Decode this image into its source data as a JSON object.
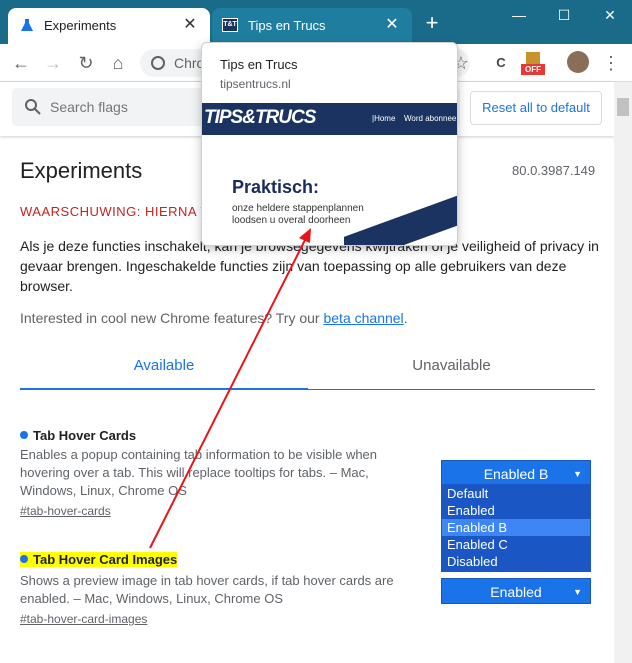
{
  "browser": {
    "tabs": [
      {
        "title": "Experiments",
        "close": "✕"
      },
      {
        "title": "Tips en Trucs",
        "close": "✕"
      }
    ],
    "new_tab": "+",
    "window": {
      "minimize": "—",
      "maximize": "☐",
      "close": "✕"
    },
    "omnibox_text": "Chro",
    "ext_c": "C",
    "ext_off_badge": "OFF",
    "nav": {
      "back": "←",
      "forward": "→",
      "reload": "↻",
      "home": "⌂"
    },
    "star": "☆",
    "menu": "⋮"
  },
  "hover_card": {
    "title": "Tips en Trucs",
    "url": "tipsentrucs.nl",
    "logo": "TIPS&TRUCS",
    "nav_home": "|Home",
    "nav_abonnee": "Word abonnee",
    "headline": "Praktisch:",
    "sub1": "onze heldere stappenplannen",
    "sub2": "loodsen u overal doorheen"
  },
  "flags_page": {
    "search_placeholder": "Search flags",
    "reset_label": "Reset all to default",
    "title": "Experiments",
    "version": "80.0.3987.149",
    "warning": "WAARSCHUWING: HIERNA V",
    "intro": "Als je deze functies inschakelt, kan je browsegegevens kwijtraken of je veiligheid of privacy in gevaar brengen. Ingeschakelde functies zijn van toepassing op alle gebruikers van deze browser.",
    "interested_prefix": "Interested in cool new Chrome features? Try our ",
    "beta_link": "beta channel",
    "interested_suffix": ".",
    "tabs": {
      "available": "Available",
      "unavailable": "Unavailable"
    },
    "flags": [
      {
        "title": "Tab Hover Cards",
        "description": "Enables a popup containing tab information to be visible when hovering over a tab. This will replace tooltips for tabs. – Mac, Windows, Linux, Chrome OS",
        "link": "#tab-hover-cards",
        "selected": "Enabled B",
        "options": [
          "Default",
          "Enabled",
          "Enabled B",
          "Enabled C",
          "Disabled"
        ]
      },
      {
        "title": "Tab Hover Card Images",
        "description": "Shows a preview image in tab hover cards, if tab hover cards are enabled. – Mac, Windows, Linux, Chrome OS",
        "link": "#tab-hover-card-images",
        "selected": "Enabled"
      }
    ]
  },
  "colors": {
    "titlebar": "#1a6b8a",
    "accent": "#1a73e8",
    "warning": "#c5221f",
    "highlight": "#ffff00",
    "annotation_arrow": "#e8141b"
  }
}
